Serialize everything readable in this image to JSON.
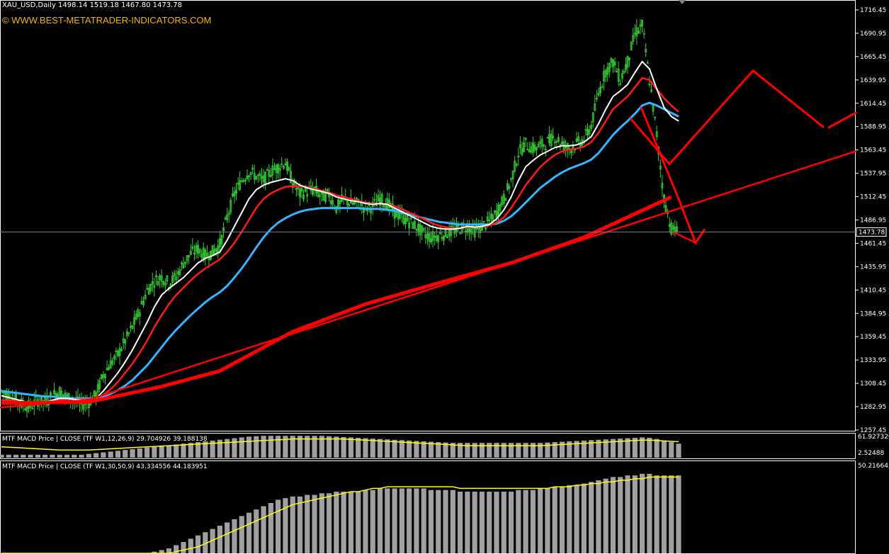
{
  "header": {
    "symbol_line": "XAU_USD,Daily  1498.14 1519.18 1467.80 1473.78",
    "website": "© WWW.BEST-METATRADER-INDICATORS.COM",
    "current_price": "1473.78"
  },
  "price_axis": {
    "ticks": [
      "1716.45",
      "1690.95",
      "1665.45",
      "1639.95",
      "1614.45",
      "1588.95",
      "1563.45",
      "1537.95",
      "1512.45",
      "1486.95",
      "1461.45",
      "1435.95",
      "1410.45",
      "1384.95",
      "1359.45",
      "1333.95",
      "1308.45",
      "1282.95",
      "1257.45"
    ]
  },
  "indicator1": {
    "label": "MTF MACD Price | CLOSE  (TF W1,12,26,9) 29.704926 39.188138",
    "axis_top": "61.927326",
    "axis_bottom": "2.52488"
  },
  "indicator2": {
    "label": "MTF MACD Price | CLOSE  (TF W1,30,50,9) 43.334556 44.183951",
    "axis_top": "50.216645"
  },
  "colors": {
    "candle": "#33cc33",
    "ma_white": "#ffffff",
    "ma_red": "#ff1a1a",
    "ma_blue": "#33b5ff",
    "trend": "#ff0000",
    "hist": "#a0a0a0",
    "signal": "#ffff00",
    "axis_text": "#ffffff"
  },
  "chart_data": [
    {
      "type": "line",
      "title": "XAU_USD,Daily",
      "y_range": [
        1257.45,
        1716.45
      ],
      "series": [
        {
          "name": "price",
          "values": [
            1300,
            1295,
            1290,
            1285,
            1283,
            1290,
            1288,
            1295,
            1300,
            1293,
            1290,
            1285,
            1288,
            1296,
            1318,
            1330,
            1340,
            1355,
            1370,
            1388,
            1410,
            1420,
            1425,
            1418,
            1425,
            1440,
            1450,
            1455,
            1448,
            1452,
            1460,
            1490,
            1515,
            1530,
            1540,
            1535,
            1530,
            1540,
            1545,
            1550,
            1528,
            1515,
            1518,
            1520,
            1512,
            1515,
            1500,
            1510,
            1505,
            1505,
            1500,
            1502,
            1510,
            1505,
            1495,
            1490,
            1485,
            1480,
            1472,
            1468,
            1470,
            1472,
            1475,
            1478,
            1480,
            1475,
            1480,
            1485,
            1495,
            1510,
            1530,
            1560,
            1570,
            1565,
            1568,
            1572,
            1578,
            1570,
            1565,
            1570,
            1575,
            1590,
            1625,
            1650,
            1660,
            1640,
            1660,
            1690,
            1700,
            1640,
            1580,
            1510,
            1478,
            1473
          ]
        },
        {
          "name": "ma-white",
          "values": [
            1295,
            1293,
            1291,
            1289,
            1287,
            1288,
            1288,
            1290,
            1292,
            1292,
            1291,
            1290,
            1290,
            1292,
            1300,
            1310,
            1320,
            1332,
            1345,
            1360,
            1375,
            1392,
            1405,
            1412,
            1418,
            1424,
            1432,
            1440,
            1445,
            1448,
            1452,
            1465,
            1480,
            1495,
            1510,
            1520,
            1525,
            1528,
            1530,
            1532,
            1530,
            1525,
            1522,
            1520,
            1518,
            1516,
            1512,
            1510,
            1508,
            1507,
            1505,
            1504,
            1505,
            1504,
            1500,
            1496,
            1492,
            1488,
            1484,
            1480,
            1478,
            1477,
            1477,
            1478,
            1480,
            1479,
            1480,
            1482,
            1488,
            1498,
            1512,
            1530,
            1545,
            1552,
            1558,
            1562,
            1566,
            1568,
            1568,
            1569,
            1572,
            1578,
            1592,
            1608,
            1622,
            1628,
            1635,
            1648,
            1660,
            1652,
            1630,
            1610,
            1600,
            1595
          ]
        },
        {
          "name": "ma-red",
          "values": [
            1290,
            1290,
            1289,
            1288,
            1288,
            1288,
            1288,
            1289,
            1290,
            1291,
            1291,
            1291,
            1291,
            1292,
            1296,
            1302,
            1310,
            1320,
            1330,
            1342,
            1355,
            1370,
            1383,
            1395,
            1405,
            1413,
            1421,
            1428,
            1434,
            1439,
            1444,
            1452,
            1462,
            1474,
            1487,
            1500,
            1510,
            1516,
            1520,
            1523,
            1524,
            1524,
            1523,
            1521,
            1519,
            1517,
            1514,
            1512,
            1510,
            1508,
            1506,
            1505,
            1505,
            1504,
            1502,
            1499,
            1495,
            1492,
            1488,
            1484,
            1481,
            1479,
            1478,
            1478,
            1479,
            1479,
            1480,
            1481,
            1484,
            1490,
            1500,
            1512,
            1525,
            1535,
            1545,
            1552,
            1558,
            1562,
            1564,
            1565,
            1567,
            1572,
            1582,
            1595,
            1608,
            1615,
            1622,
            1632,
            1642,
            1640,
            1630,
            1620,
            1612,
            1605
          ]
        },
        {
          "name": "ma-blue",
          "values": [
            1300,
            1299,
            1298,
            1297,
            1296,
            1295,
            1294,
            1294,
            1293,
            1293,
            1292,
            1292,
            1292,
            1292,
            1294,
            1297,
            1301,
            1306,
            1312,
            1320,
            1328,
            1338,
            1348,
            1358,
            1367,
            1375,
            1383,
            1390,
            1397,
            1403,
            1408,
            1415,
            1424,
            1434,
            1445,
            1457,
            1468,
            1477,
            1484,
            1489,
            1493,
            1496,
            1498,
            1499,
            1500,
            1500,
            1500,
            1500,
            1500,
            1500,
            1499,
            1499,
            1499,
            1498,
            1497,
            1495,
            1493,
            1491,
            1489,
            1487,
            1485,
            1484,
            1483,
            1482,
            1482,
            1482,
            1482,
            1482,
            1483,
            1486,
            1491,
            1498,
            1506,
            1514,
            1522,
            1528,
            1534,
            1539,
            1543,
            1546,
            1549,
            1553,
            1560,
            1570,
            1580,
            1588,
            1595,
            1603,
            1612,
            1615,
            1612,
            1608,
            1604,
            1600
          ]
        }
      ]
    },
    {
      "type": "bar",
      "title": "MTF MACD Price | CLOSE (TF W1,12,26,9)",
      "y_range": [
        2.52488,
        61.927326
      ],
      "series": [
        {
          "name": "macd",
          "values": [
            10,
            10,
            10,
            10,
            10,
            10,
            10,
            10,
            10,
            10,
            10,
            10,
            12,
            14,
            16,
            18,
            20,
            22,
            24,
            26,
            28,
            30,
            32,
            34,
            36,
            38,
            40,
            42,
            44,
            46,
            48,
            50,
            52,
            54,
            56,
            57,
            58,
            58,
            58,
            58,
            58,
            58,
            58,
            58,
            58,
            57,
            56,
            55,
            54,
            53,
            52,
            51,
            50,
            49,
            48,
            47,
            46,
            45,
            44,
            43,
            42,
            41,
            40,
            40,
            40,
            40,
            40,
            40,
            40,
            40,
            40,
            40,
            40,
            40,
            40,
            41,
            42,
            43,
            44,
            45,
            46,
            47,
            48,
            49,
            50,
            51,
            52,
            53,
            54,
            53,
            50,
            46,
            42,
            38
          ]
        },
        {
          "name": "signal",
          "values": [
            30,
            29,
            28,
            27,
            26,
            25,
            24,
            23,
            22,
            22,
            22,
            22,
            22,
            23,
            24,
            25,
            26,
            27,
            28,
            29,
            30,
            31,
            32,
            33,
            34,
            35,
            36,
            37,
            38,
            39,
            40,
            41,
            42,
            43,
            44,
            45,
            46,
            47,
            48,
            49,
            50,
            50,
            50,
            50,
            50,
            50,
            50,
            50,
            49,
            48,
            47,
            46,
            45,
            44,
            43,
            42,
            41,
            40,
            39,
            38,
            37,
            36,
            35,
            34,
            33,
            33,
            33,
            33,
            33,
            33,
            33,
            33,
            33,
            33,
            33,
            34,
            35,
            36,
            37,
            38,
            39,
            40,
            41,
            42,
            43,
            44,
            45,
            46,
            47,
            47,
            46,
            45,
            44,
            43
          ]
        }
      ]
    },
    {
      "type": "bar",
      "title": "MTF MACD Price | CLOSE (TF W1,30,50,9)",
      "y_range": [
        0,
        50.216645
      ],
      "series": [
        {
          "name": "macd",
          "values": [
            0,
            0,
            0,
            0,
            0,
            0,
            0,
            0,
            0,
            0,
            0,
            0,
            0,
            0,
            0,
            0,
            0,
            0,
            0,
            0,
            0,
            1,
            2,
            3,
            5,
            7,
            9,
            11,
            13,
            15,
            17,
            19,
            21,
            23,
            25,
            27,
            29,
            31,
            33,
            34,
            35,
            35,
            36,
            36,
            37,
            37,
            38,
            38,
            38,
            38,
            39,
            39,
            40,
            40,
            40,
            40,
            40,
            40,
            40,
            39,
            39,
            39,
            39,
            38,
            38,
            38,
            38,
            38,
            38,
            38,
            38,
            39,
            39,
            39,
            40,
            40,
            41,
            41,
            42,
            42,
            43,
            44,
            45,
            46,
            47,
            47,
            48,
            48,
            49,
            49,
            48,
            48,
            48,
            48
          ]
        },
        {
          "name": "signal",
          "values": [
            0,
            0,
            0,
            0,
            0,
            0,
            0,
            0,
            0,
            0,
            0,
            0,
            0,
            0,
            0,
            0,
            0,
            0,
            0,
            0,
            0,
            0,
            0,
            0,
            1,
            2,
            3,
            4,
            6,
            8,
            10,
            12,
            14,
            16,
            18,
            20,
            22,
            24,
            26,
            28,
            30,
            31,
            32,
            33,
            34,
            35,
            36,
            37,
            38,
            38,
            39,
            40,
            40,
            41,
            41,
            41,
            41,
            41,
            41,
            41,
            41,
            41,
            41,
            40,
            40,
            40,
            40,
            40,
            40,
            40,
            40,
            40,
            40,
            40,
            40,
            40,
            41,
            41,
            41,
            42,
            42,
            43,
            43,
            44,
            44,
            45,
            45,
            46,
            46,
            47,
            47,
            47,
            47,
            47
          ]
        }
      ]
    }
  ]
}
